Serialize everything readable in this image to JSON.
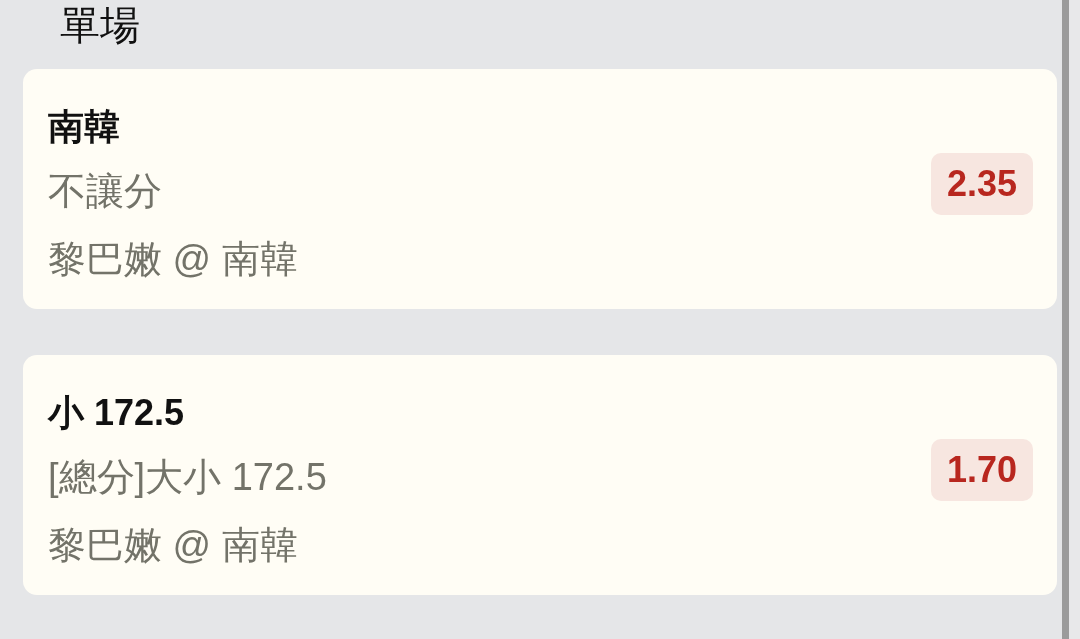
{
  "section": {
    "title": "單場"
  },
  "bets": [
    {
      "selection": "南韓",
      "market": "不讓分",
      "match": "黎巴嫩 @ 南韓",
      "odds": "2.35"
    },
    {
      "selection": "小 172.5",
      "market": "[總分]大小 172.5",
      "match": "黎巴嫩 @ 南韓",
      "odds": "1.70"
    }
  ]
}
